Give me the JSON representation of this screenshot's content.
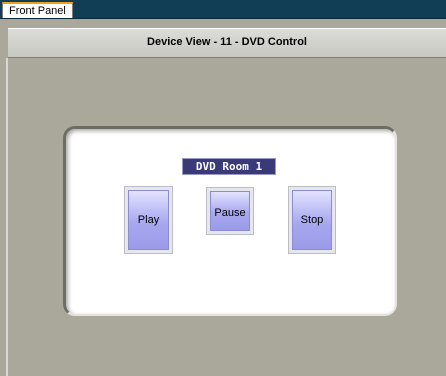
{
  "tabs": [
    {
      "label": "Front Panel",
      "active": true
    }
  ],
  "window": {
    "title": "Device View - 11 - DVD Control"
  },
  "device": {
    "room_label": "DVD Room 1",
    "buttons": {
      "play": "Play",
      "pause": "Pause",
      "stop": "Stop"
    }
  },
  "colors": {
    "tabbar": "#123e55",
    "background": "#a9a89a",
    "panel": "#ffffff",
    "room_label_bg": "#3a3a78",
    "button_face": "#a8a8f0"
  }
}
